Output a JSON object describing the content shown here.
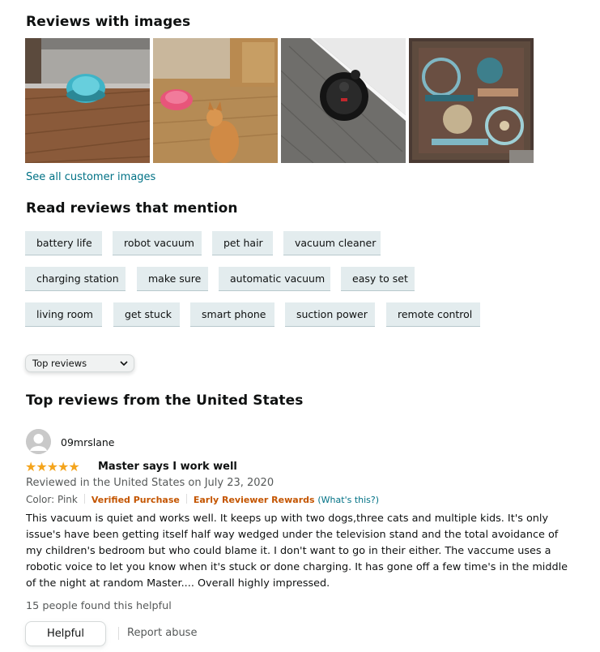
{
  "images_section": {
    "title": "Reviews with images",
    "images": [
      {
        "alt": "blue robot vacuum on wood floor"
      },
      {
        "alt": "pink robot vacuum with dog"
      },
      {
        "alt": "black robot vacuum near wall"
      },
      {
        "alt": "patterned rug"
      }
    ],
    "see_all_label": "See all customer images"
  },
  "mentions": {
    "title": "Read reviews that mention",
    "chips": [
      "battery life",
      "robot vacuum",
      "pet hair",
      "vacuum cleaner",
      "charging station",
      "make sure",
      "automatic vacuum",
      "easy to set",
      "living room",
      "get stuck",
      "smart phone",
      "suction power",
      "remote control"
    ]
  },
  "sort": {
    "selected": "Top reviews"
  },
  "top_reviews_title": "Top reviews from the United States",
  "review": {
    "author": "09mrslane",
    "rating": 5,
    "title": "Master says I work well",
    "reviewed_line": "Reviewed in the United States on July 23, 2020",
    "color": "Color: Pink",
    "verified": "Verified Purchase",
    "early_reviewer": "Early Reviewer Rewards",
    "whats_this": "(What's this?)",
    "body": "This vacuum is quiet and works well. It keeps up with two dogs,three cats and multiple kids. It's only issue's have been getting itself half way wedged under the television stand and the total avoidance of my children's bedroom but who could blame it. I don't want to go in their either. The vaccume uses a robotic voice to let you know when it's stuck or done charging. It has gone off a few time's in the middle of the night at random Master.... Overall highly impressed.",
    "helpful_count": "15 people found this helpful",
    "helpful_label": "Helpful",
    "report_label": "Report abuse"
  },
  "colors": {
    "link": "#007185",
    "badge": "#c45500",
    "star": "#f4a41c",
    "chip_bg": "#e3ecee"
  },
  "icons": {
    "sort_chevron": "chevron-down-icon",
    "avatar": "user-avatar-icon",
    "stars": "star-icon"
  }
}
